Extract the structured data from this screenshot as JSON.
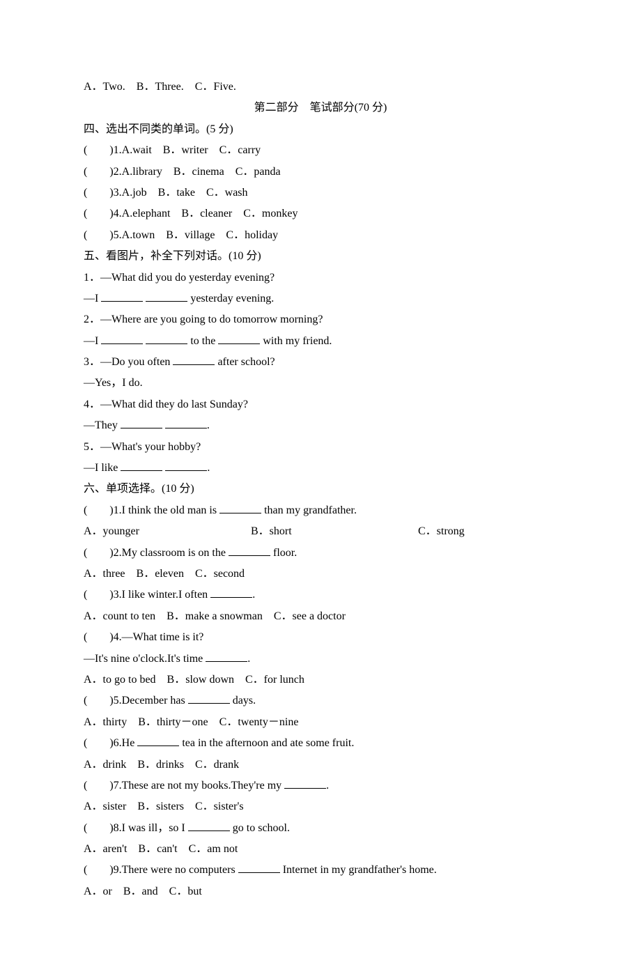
{
  "topOptions": "A．Two.　B．Three.　C．Five.",
  "part2Title": "第二部分　笔试部分(70 分)",
  "section4": {
    "heading": "四、选出不同类的单词。(5 分)",
    "items": [
      "(　　)1.A.wait　B．writer　C．carry",
      "(　　)2.A.library　B．cinema　C．panda",
      "(　　)3.A.job　B．take　C．wash",
      "(　　)4.A.elephant　B．cleaner　C．monkey",
      "(　　)5.A.town　B．village　C．holiday"
    ]
  },
  "section5": {
    "heading": "五、看图片，补全下列对话。(10 分)",
    "items": [
      {
        "q": "1．—What did you do yesterday evening?",
        "a_pre": "—I ",
        "a_post": " yesterday evening."
      },
      {
        "q": "2．—Where are you going to do tomorrow morning?",
        "a_pre": "—I ",
        "a_mid": " to the ",
        "a_post": " with my friend."
      },
      {
        "q_pre": "3．—Do you often ",
        "q_post": " after school?",
        "a": "—Yes，I do."
      },
      {
        "q": "4．—What did they do last Sunday?",
        "a_pre": "—They ",
        "a_post": "."
      },
      {
        "q": "5．—What's your hobby?",
        "a_pre": "—I like ",
        "a_post": "."
      }
    ]
  },
  "section6": {
    "heading": "六、单项选择。(10 分)",
    "q1": {
      "stem_pre": "(　　)1.I think the old man is ",
      "stem_post": " than my grandfather.",
      "a": "A．younger",
      "b": "B．short",
      "c": "C．strong"
    },
    "q2": {
      "stem_pre": "(　　)2.My classroom is on the ",
      "stem_post": " floor.",
      "opts": "A．three　B．eleven　C．second"
    },
    "q3": {
      "stem_pre": "(　　)3.I like winter.I often ",
      "stem_post": ".",
      "opts": "A．count to ten　B．make a snowman　C．see a doctor"
    },
    "q4": {
      "stem": "(　　)4.—What time is it?",
      "line2_pre": "—It's nine o'clock.It's time ",
      "line2_post": ".",
      "opts": "A．to go to bed　B．slow down　C．for lunch"
    },
    "q5": {
      "stem_pre": "(　　)5.December has ",
      "stem_post": " days.",
      "opts": "A．thirty　B．thirty－one　C．twenty－nine"
    },
    "q6": {
      "stem_pre": "(　　)6.He ",
      "stem_post": " tea in the afternoon and ate some fruit.",
      "opts": "A．drink　B．drinks　C．drank"
    },
    "q7": {
      "stem_pre": "(　　)7.These are not my books.They're my ",
      "stem_post": ".",
      "opts": "A．sister　B．sisters　C．sister's"
    },
    "q8": {
      "stem_pre": "(　　)8.I was ill，so I ",
      "stem_post": " go to school.",
      "opts": "A．aren't　B．can't　C．am not"
    },
    "q9": {
      "stem_pre": "(　　)9.There were no computers ",
      "stem_post": " Internet in my grandfather's home.",
      "opts": "A．or　B．and　C．but"
    }
  }
}
